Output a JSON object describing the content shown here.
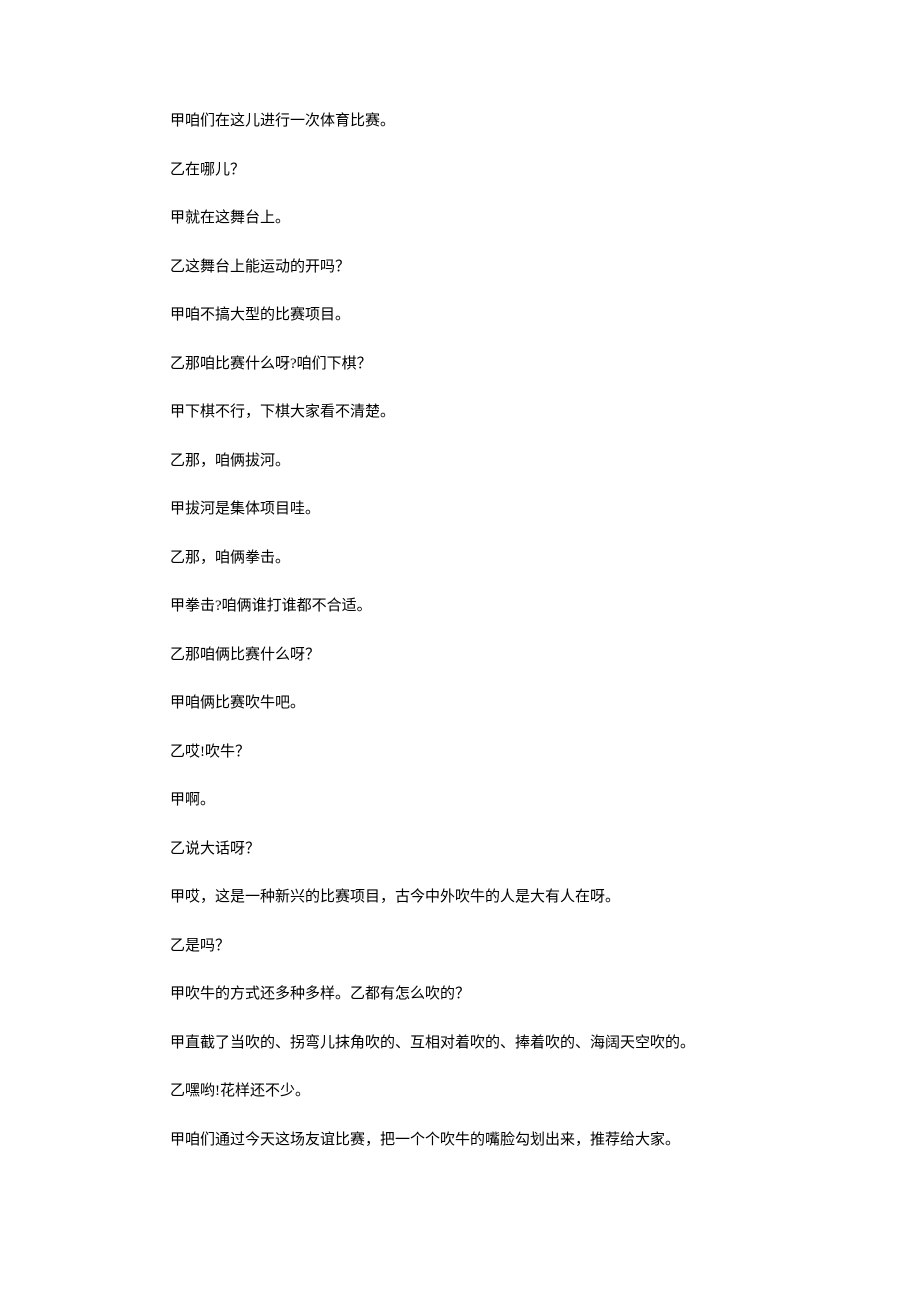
{
  "document": {
    "lines": [
      "甲咱们在这儿进行一次体育比赛。",
      "乙在哪儿？",
      "甲就在这舞台上。",
      "乙这舞台上能运动的开吗？",
      "甲咱不搞大型的比赛项目。",
      "乙那咱比赛什么呀?咱们下棋？",
      "甲下棋不行，下棋大家看不清楚。",
      "乙那，咱俩拔河。",
      "甲拔河是集体项目哇。",
      "乙那，咱俩拳击。",
      "甲拳击?咱俩谁打谁都不合适。",
      "乙那咱俩比赛什么呀？",
      "甲咱俩比赛吹牛吧。",
      "乙哎!吹牛？",
      "甲啊。",
      "乙说大话呀？",
      "甲哎，这是一种新兴的比赛项目，古今中外吹牛的人是大有人在呀。",
      "乙是吗？",
      "甲吹牛的方式还多种多样。乙都有怎么吹的？",
      "甲直截了当吹的、拐弯儿抹角吹的、互相对着吹的、捧着吹的、海阔天空吹的。",
      "乙嘿哟!花样还不少。",
      "甲咱们通过今天这场友谊比赛，把一个个吹牛的嘴脸勾划出来，推荐给大家。"
    ]
  }
}
